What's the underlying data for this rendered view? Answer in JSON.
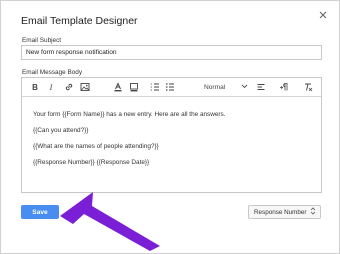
{
  "dialog": {
    "title": "Email Template Designer"
  },
  "subject": {
    "label": "Email Subject",
    "value": "New form response notification"
  },
  "body": {
    "label": "Email Message Body",
    "toolbar": {
      "bold": "B",
      "italic": "I",
      "format_value": "Normal"
    },
    "lines": [
      "Your form {{Form Name}} has a new entry. Here are all the answers.",
      "{{Can you attend?}}",
      "{{What are the names of people attending?}}",
      "{{Response Number}} {{Response Date}}"
    ]
  },
  "footer": {
    "save_label": "Save",
    "placeholder_select_value": "Response Number"
  },
  "colors": {
    "accent": "#4a8df0",
    "annotation_arrow": "#7b1fd6"
  },
  "icons": [
    "close-icon",
    "bold-icon",
    "italic-icon",
    "link-icon",
    "image-icon",
    "text-color-icon",
    "highlight-icon",
    "numbered-list-icon",
    "bulleted-list-icon",
    "chevron-down-icon",
    "align-icon",
    "rtl-icon",
    "clear-format-icon",
    "updown-icon"
  ]
}
